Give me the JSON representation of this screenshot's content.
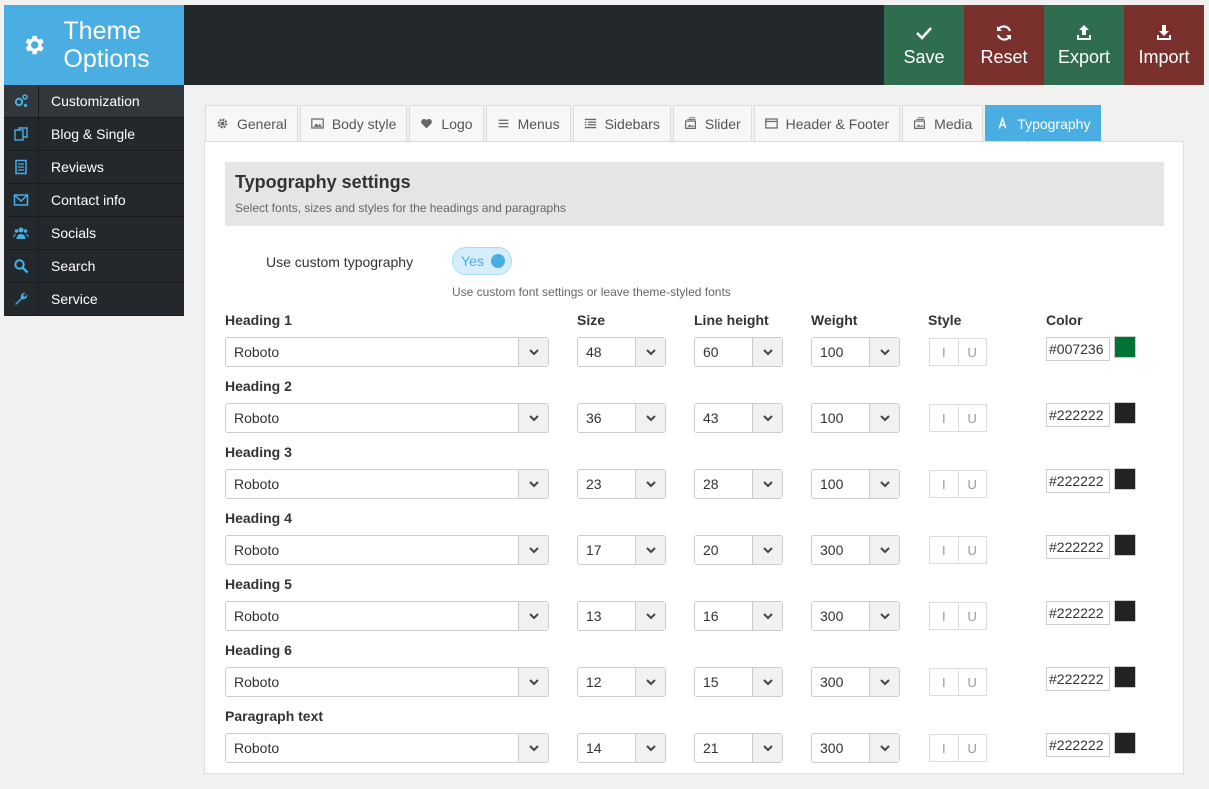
{
  "brand": {
    "title": "Theme Options"
  },
  "actions": [
    {
      "label": "Save",
      "icon": "check-icon"
    },
    {
      "label": "Reset",
      "icon": "refresh-icon"
    },
    {
      "label": "Export",
      "icon": "export-icon"
    },
    {
      "label": "Import",
      "icon": "import-icon"
    }
  ],
  "sidebar": {
    "items": [
      {
        "label": "Customization",
        "icon": "cogs-icon",
        "active": true
      },
      {
        "label": "Blog & Single",
        "icon": "copy-icon"
      },
      {
        "label": "Reviews",
        "icon": "document-icon"
      },
      {
        "label": "Contact info",
        "icon": "envelope-icon"
      },
      {
        "label": "Socials",
        "icon": "users-icon"
      },
      {
        "label": "Search",
        "icon": "search-icon"
      },
      {
        "label": "Service",
        "icon": "wrench-icon"
      }
    ]
  },
  "tabs": [
    {
      "label": "General",
      "icon": "gear-icon"
    },
    {
      "label": "Body style",
      "icon": "image-icon"
    },
    {
      "label": "Logo",
      "icon": "heart-icon"
    },
    {
      "label": "Menus",
      "icon": "menu-icon"
    },
    {
      "label": "Sidebars",
      "icon": "list-icon"
    },
    {
      "label": "Slider",
      "icon": "slider-icon"
    },
    {
      "label": "Header & Footer",
      "icon": "window-icon"
    },
    {
      "label": "Media",
      "icon": "media-icon"
    },
    {
      "label": "Typography",
      "icon": "font-icon",
      "active": true
    }
  ],
  "section": {
    "title": "Typography settings",
    "description": "Select fonts, sizes and styles for the headings and paragraphs"
  },
  "custom": {
    "label": "Use custom typography",
    "toggle_value": "Yes",
    "description": "Use custom font settings or leave theme-styled fonts"
  },
  "columns": {
    "size": "Size",
    "line_height": "Line height",
    "weight": "Weight",
    "style": "Style",
    "color": "Color"
  },
  "style_buttons": {
    "italic": "I",
    "underline": "U"
  },
  "rows": [
    {
      "label": "Heading 1",
      "font": "Roboto",
      "size": "48",
      "line_height": "60",
      "weight": "100",
      "color": "#007236"
    },
    {
      "label": "Heading 2",
      "font": "Roboto",
      "size": "36",
      "line_height": "43",
      "weight": "100",
      "color": "#222222"
    },
    {
      "label": "Heading 3",
      "font": "Roboto",
      "size": "23",
      "line_height": "28",
      "weight": "100",
      "color": "#222222"
    },
    {
      "label": "Heading 4",
      "font": "Roboto",
      "size": "17",
      "line_height": "20",
      "weight": "300",
      "color": "#222222"
    },
    {
      "label": "Heading 5",
      "font": "Roboto",
      "size": "13",
      "line_height": "16",
      "weight": "300",
      "color": "#222222"
    },
    {
      "label": "Heading 6",
      "font": "Roboto",
      "size": "12",
      "line_height": "15",
      "weight": "300",
      "color": "#222222"
    },
    {
      "label": "Paragraph text",
      "font": "Roboto",
      "size": "14",
      "line_height": "21",
      "weight": "300",
      "color": "#222222"
    }
  ]
}
